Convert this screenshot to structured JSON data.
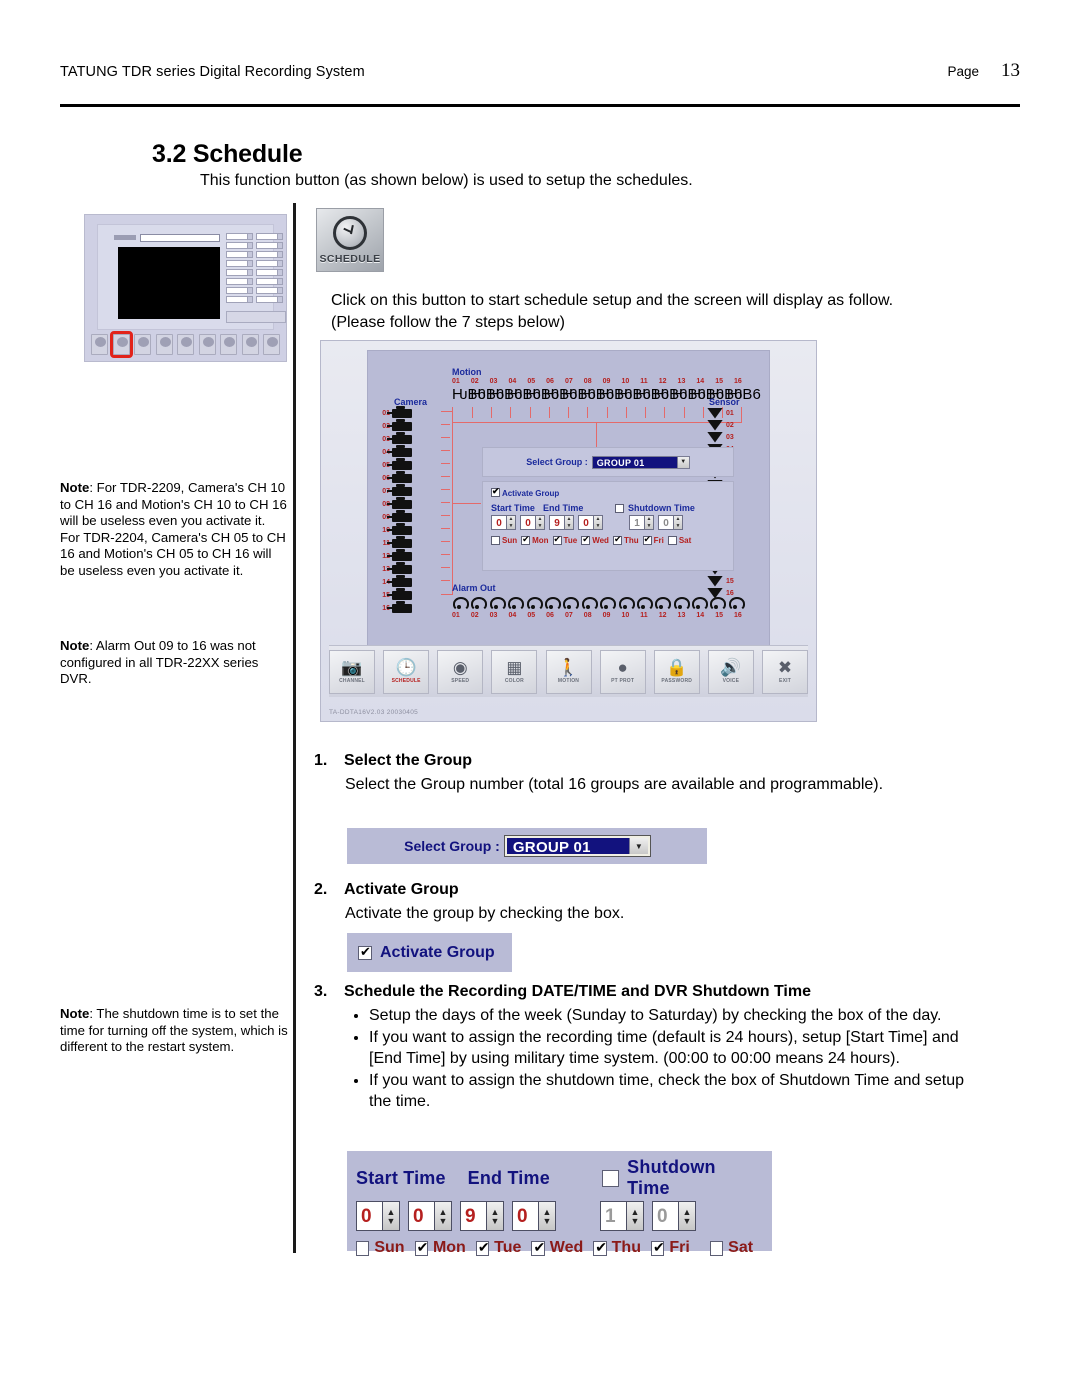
{
  "header": {
    "doc_title": "TATUNG TDR series Digital Recording System",
    "page_word": "Page",
    "page_number": "13"
  },
  "section": {
    "title": "3.2 Schedule",
    "intro": "This function button (as shown below) is used to setup the schedules.",
    "click_paragraph": "Click on this button to start schedule setup and the screen will display as follow. (Please follow the 7 steps below)"
  },
  "schedule_button": {
    "label": "SCHEDULE",
    "icon": "clock-icon"
  },
  "dvr_screen": {
    "motion_title": "Motion",
    "camera_title": "Camera",
    "sensor_title": "Sensor",
    "alarm_title": "Alarm Out",
    "channels": [
      "01",
      "02",
      "03",
      "04",
      "05",
      "06",
      "07",
      "08",
      "09",
      "10",
      "11",
      "12",
      "13",
      "14",
      "15",
      "16"
    ],
    "select_group_label": "Select Group :",
    "select_group_value": "GROUP 01",
    "activate_group_label": "Activate Group",
    "activate_group_checked": true,
    "start_time_label": "Start Time",
    "end_time_label": "End Time",
    "shutdown_time_label": "Shutdown Time",
    "shutdown_checked": false,
    "start_time_digits": [
      "0",
      "0"
    ],
    "end_time_digits": [
      "9",
      "0"
    ],
    "shutdown_digits": [
      "1",
      "0"
    ],
    "days": [
      {
        "name": "Sun",
        "checked": false
      },
      {
        "name": "Mon",
        "checked": true
      },
      {
        "name": "Tue",
        "checked": true
      },
      {
        "name": "Wed",
        "checked": true
      },
      {
        "name": "Thu",
        "checked": true
      },
      {
        "name": "Fri",
        "checked": true
      },
      {
        "name": "Sat",
        "checked": false
      }
    ],
    "toolbar": [
      {
        "label": "CHANNEL",
        "icon": "camera-icon",
        "active": false
      },
      {
        "label": "SCHEDULE",
        "icon": "clock-icon",
        "active": true
      },
      {
        "label": "SPEED",
        "icon": "speed-gauge-icon",
        "active": false
      },
      {
        "label": "COLOR",
        "icon": "color-bars-icon",
        "active": false
      },
      {
        "label": "MOTION",
        "icon": "running-person-icon",
        "active": false
      },
      {
        "label": "PT PROT",
        "icon": "dome-camera-icon",
        "active": false
      },
      {
        "label": "PASSWORD",
        "icon": "lock-icon",
        "active": false
      },
      {
        "label": "VOICE",
        "icon": "speaker-icon",
        "active": false
      },
      {
        "label": "EXIT",
        "icon": "close-circle-icon",
        "active": false
      }
    ],
    "version_text": "TA-DDTA16V2.03 20030405"
  },
  "notes": [
    {
      "bold": "Note",
      "text": ": For TDR-2209, Camera's CH 10 to CH 16 and Motion's CH 10 to CH 16 will be useless even you activate it. For TDR-2204, Camera's CH 05 to CH 16 and Motion's CH 05 to CH 16 will be useless even you activate it."
    },
    {
      "bold": "Note",
      "text": ": Alarm Out 09 to 16 was not configured in all TDR-22XX series DVR."
    },
    {
      "bold": "Note",
      "text": ": The shutdown time is to set the time for turning off the system, which is different to the restart system."
    }
  ],
  "steps": [
    {
      "number": "1.",
      "title": "Select the Group",
      "body": "Select the Group number (total 16 groups are available and programmable)."
    },
    {
      "number": "2.",
      "title": "Activate Group",
      "body": "Activate the group by checking the box."
    },
    {
      "number": "3.",
      "title": "Schedule the Recording DATE/TIME and DVR Shutdown Time",
      "bullets": [
        "Setup the days of the week (Sunday to Saturday) by checking the box of the day.",
        "If you want to assign the recording time (default is 24 hours), setup [Start Time] and [End Time] by using military time system. (00:00 to 00:00 means 24 hours).",
        "If you want to assign the shutdown time, check the box of Shutdown Time and setup the time."
      ]
    }
  ],
  "widgets": {
    "select_group": {
      "label": "Select Group :",
      "value": "GROUP 01",
      "arrow": "chevron-down-icon"
    },
    "activate_group": {
      "label": "Activate Group",
      "checked": true
    },
    "time_panel": {
      "start_time_label": "Start Time",
      "end_time_label": "End Time",
      "shutdown_time_label": "Shutdown Time",
      "shutdown_checked": false,
      "start_digits": [
        "0",
        "0"
      ],
      "end_digits": [
        "9",
        "0"
      ],
      "shutdown_digits": [
        "1",
        "0"
      ],
      "days": [
        {
          "name": "Sun",
          "checked": false
        },
        {
          "name": "Mon",
          "checked": true
        },
        {
          "name": "Tue",
          "checked": true
        },
        {
          "name": "Wed",
          "checked": true
        },
        {
          "name": "Thu",
          "checked": true
        },
        {
          "name": "Fri",
          "checked": true
        },
        {
          "name": "Sat",
          "checked": false
        }
      ]
    }
  },
  "colors": {
    "blue_label": "#12127e",
    "red_value": "#b5201f",
    "panel_bg": "#b9bbd6",
    "dark_red_day": "#8b1a18"
  }
}
